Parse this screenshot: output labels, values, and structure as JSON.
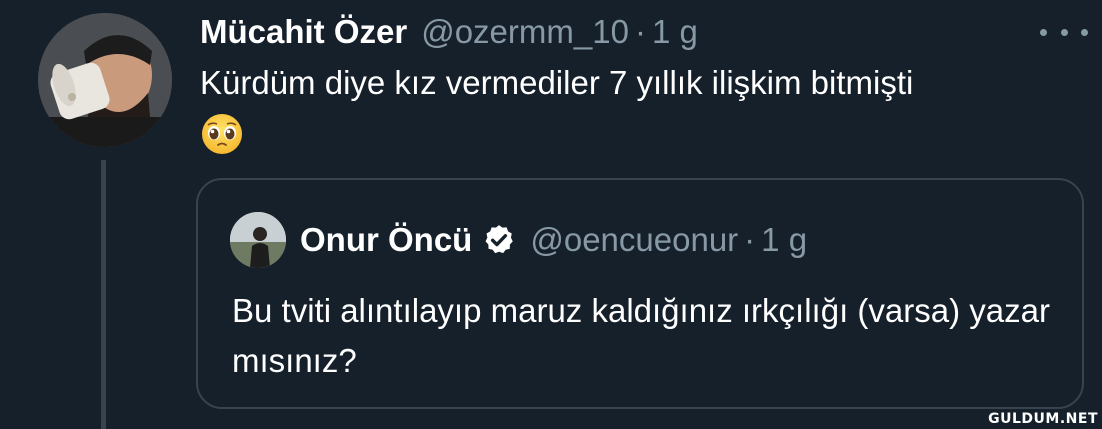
{
  "tweet": {
    "author_name": "Mücahit Özer",
    "author_handle": "@ozermm_10",
    "separator": "·",
    "time": "1 g",
    "text": "Kürdüm diye kız vermediler 7 yıllık ilişkim bitmişti",
    "emoji": "pleading-face-emoji",
    "more_icon": "more-icon"
  },
  "quoted_tweet": {
    "author_name": "Onur Öncü",
    "author_handle": "@oencueonur",
    "separator": "·",
    "time": "1 g",
    "verified_icon": "verified-badge-icon",
    "text": "Bu tviti alıntılayıp maruz kaldığınız ırkçılığı (varsa) yazar mısınız?"
  },
  "watermark": "GULDUM.NET",
  "colors": {
    "background": "#15202b",
    "secondary_text": "#8899a6",
    "border": "#38444d",
    "primary_text": "#ffffff"
  }
}
